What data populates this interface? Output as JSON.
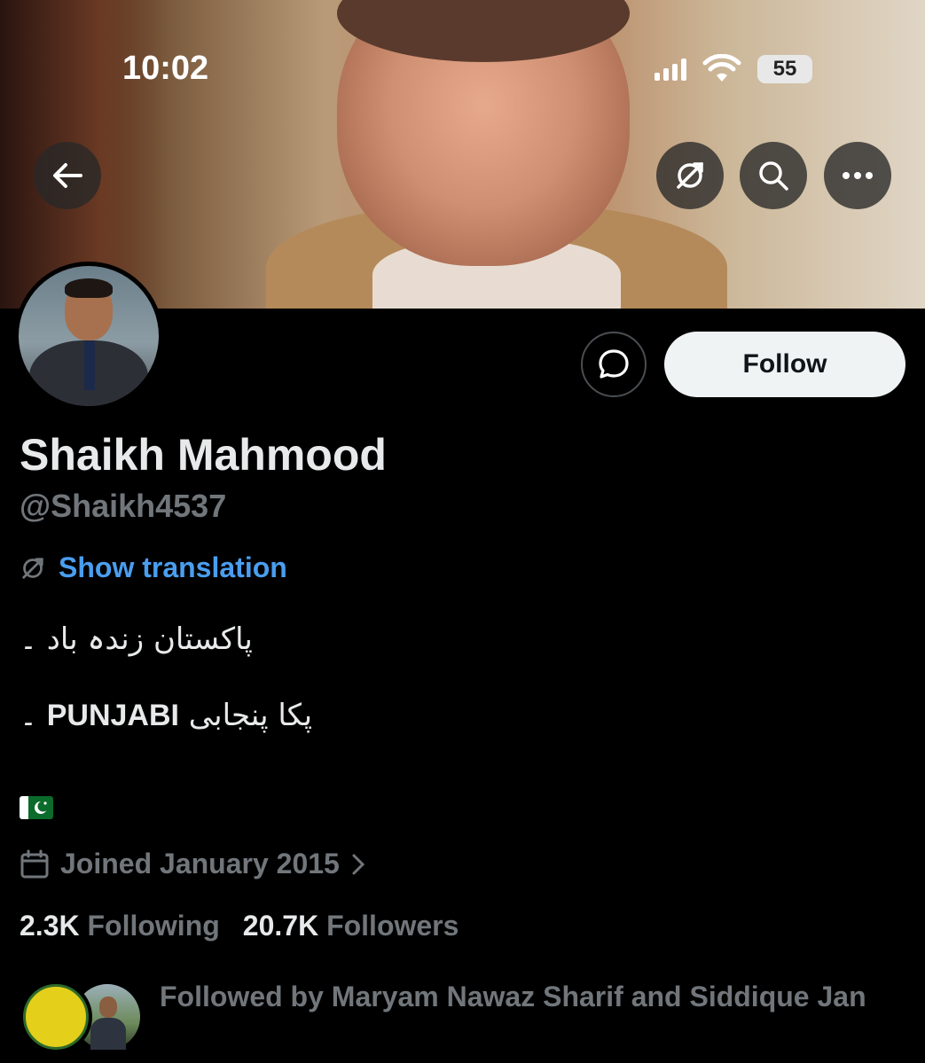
{
  "status_bar": {
    "time": "10:02",
    "battery": "55"
  },
  "header": {
    "back_icon": "arrow-left-icon",
    "translate_icon": "translate-icon",
    "search_icon": "search-icon",
    "more_icon": "more-horizontal-icon"
  },
  "profile": {
    "name": "Shaikh Mahmood",
    "handle": "@Shaikh4537",
    "show_translation": "Show translation",
    "bio_line1": "پاکستان زندہ باد ۔",
    "bio_line2_urdu": "پکا پنجابی",
    "bio_line2_latin": "PUNJABI",
    "bio_line2_suffix": "۔",
    "flag_icon": "pakistan-flag-icon",
    "joined": "Joined January 2015",
    "following_count": "2.3K",
    "following_label": "Following",
    "followers_count": "20.7K",
    "followers_label": "Followers",
    "followed_by": "Followed by Maryam Nawaz Sharif and Siddique Jan"
  },
  "actions": {
    "follow_label": "Follow",
    "message_icon": "message-icon"
  },
  "colors": {
    "background": "#000000",
    "accent_link": "#4a9eef",
    "muted_text": "#71767b",
    "follow_button_bg": "#eff3f4"
  }
}
